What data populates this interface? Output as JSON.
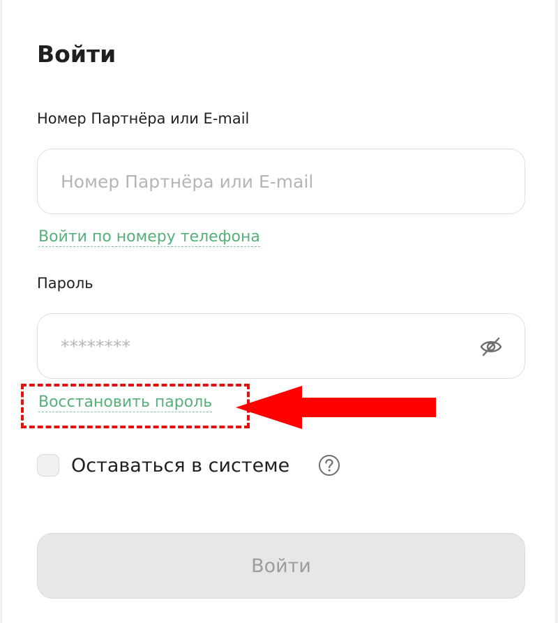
{
  "form": {
    "title": "Войти",
    "login_label": "Номер Партнёра или E-mail",
    "login_placeholder": "Номер Партнёра или E-mail",
    "login_value": "",
    "phone_link": "Войти по номеру телефона",
    "password_label": "Пароль",
    "password_placeholder": "********",
    "password_value": "",
    "password_toggle_icon": "eye-slash-icon",
    "recover_link": "Восстановить пароль",
    "remember_label": "Оставаться в системе",
    "remember_checked": false,
    "help_icon": "question-circle-icon",
    "submit_label": "Войти",
    "submit_disabled": true
  },
  "annotation": {
    "highlight_color": "#e3100f",
    "arrow_color": "#ff0000",
    "points_to": "recover-password-link"
  },
  "colors": {
    "link": "#56b07a",
    "text": "#1f1f1f",
    "placeholder": "#b5b5b5",
    "button_disabled_bg": "#e7e7e7",
    "button_disabled_text": "#9c9c9c"
  }
}
